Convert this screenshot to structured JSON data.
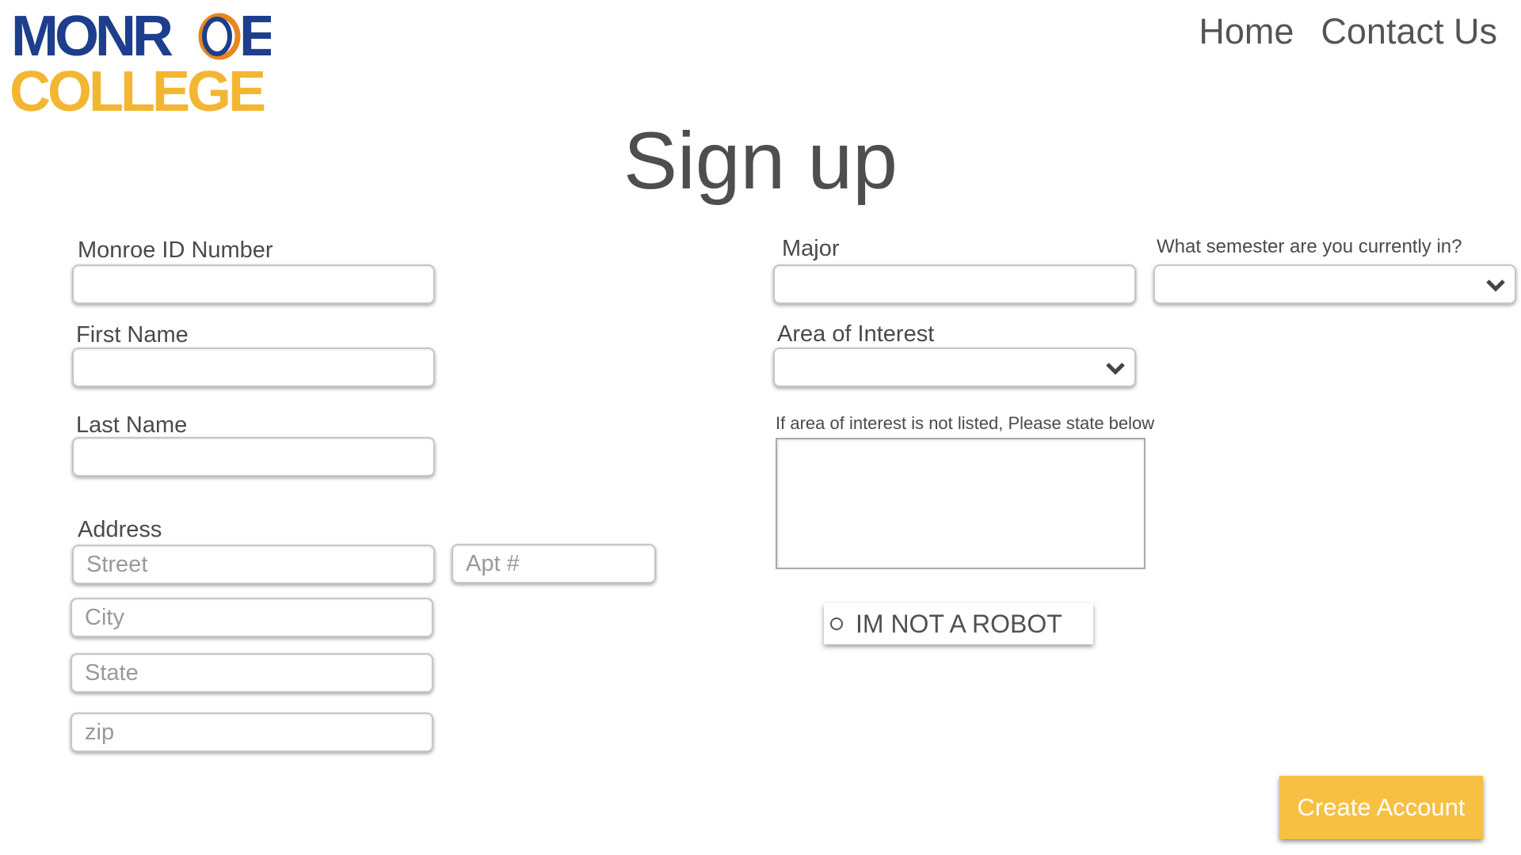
{
  "logo": {
    "line1": "MONROE",
    "line2": "COLLEGE",
    "colors": {
      "navy": "#1d3e8c",
      "gold": "#f3b632",
      "orange": "#e8861c"
    }
  },
  "nav": {
    "home": "Home",
    "contact": "Contact Us"
  },
  "title": "Sign up",
  "form": {
    "monroe_id_label": "Monroe ID Number",
    "first_name_label": "First Name",
    "last_name_label": "Last Name",
    "address_label": "Address",
    "street_placeholder": "Street",
    "apt_placeholder": "Apt #",
    "city_placeholder": "City",
    "state_placeholder": "State",
    "zip_placeholder": "zip",
    "major_label": "Major",
    "semester_label": "What semester are you currently in?",
    "area_label": "Area of Interest",
    "area_other_label": "If area of interest is not listed, Please state below",
    "robot_label": "IM NOT A ROBOT",
    "submit_label": "Create Account"
  },
  "colors": {
    "button": "#f7c043",
    "text": "#505050"
  }
}
